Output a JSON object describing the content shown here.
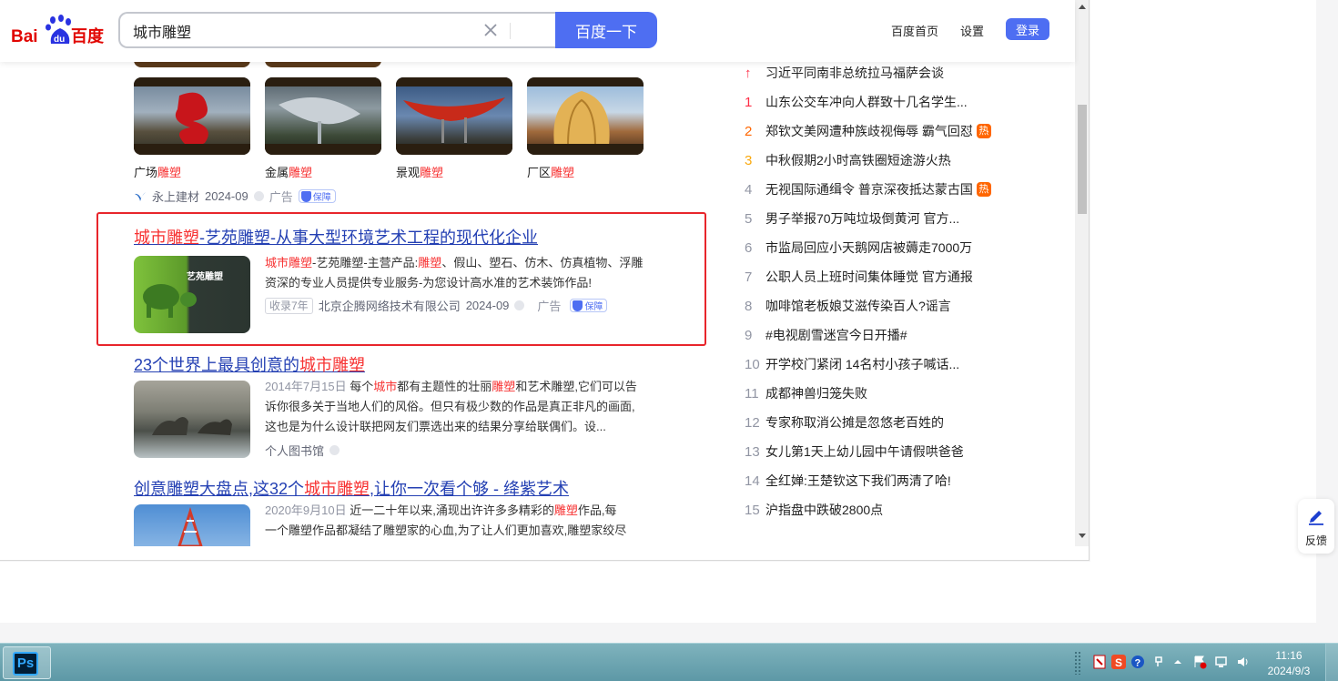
{
  "header": {
    "logo_text": "Bai百度",
    "search_value": "城市雕塑",
    "search_button": "百度一下",
    "links": [
      "百度首页",
      "设置"
    ],
    "login": "登录"
  },
  "ad_gallery": {
    "items": [
      {
        "prefix": "广场",
        "hl": "雕塑"
      },
      {
        "prefix": "金属",
        "hl": "雕塑"
      },
      {
        "prefix": "景观",
        "hl": "雕塑"
      },
      {
        "prefix": "厂区",
        "hl": "雕塑"
      }
    ],
    "meta": {
      "source": "永上建材",
      "date": "2024-09",
      "ad": "广告",
      "bao": "保障"
    }
  },
  "results": [
    {
      "title_hl": "城市雕塑",
      "title_rest": "-艺苑雕塑-从事大型环境艺术工程的现代化企业",
      "thumb_text": "艺苑雕塑",
      "line1_hl1": "城市雕塑",
      "line1_mid": "-艺苑雕塑-主营产品:",
      "line1_hl2": "雕塑",
      "line1_rest": "、假山、塑石、仿木、仿真植物、浮雕",
      "line2": "资深的专业人员提供专业服务-为您设计高水准的艺术装饰作品!",
      "tag": "收录7年",
      "source": "北京企腾网络技术有限公司",
      "date": "2024-09",
      "ad": "广告",
      "bao": "保障"
    },
    {
      "title_pre": "23个世界上最具创意的",
      "title_hl": "城市雕塑",
      "date": "2014年7月15日",
      "l1_a": "每个",
      "l1_hl1": "城市",
      "l1_b": "都有主题性的壮丽",
      "l1_hl2": "雕塑",
      "l1_c": "和艺术雕塑,它们可以告",
      "line2": "诉你很多关于当地人们的风俗。但只有极少数的作品是真正非凡的画面,",
      "line3": "这也是为什么设计联把网友们票选出来的结果分享给联偶们。设...",
      "source": "个人图书馆"
    },
    {
      "title_pre": "创意雕塑大盘点,这32个",
      "title_hl": "城市雕塑",
      "title_post": ",让你一次看个够 - 绛紫艺术",
      "date": "2020年9月10日",
      "l1_a": "近一二十年以来,涌现出许许多多精彩的",
      "l1_hl": "雕塑",
      "l1_b": "作品,每",
      "line2": "一个雕塑作品都凝结了雕塑家的心血,为了让人们更加喜欢,雕塑家绞尽"
    }
  ],
  "hotlist": [
    {
      "rank": "↑",
      "text": "习近平同南非总统拉马福萨会谈",
      "badge": ""
    },
    {
      "rank": "1",
      "text": "山东公交车冲向人群致十几名学生...",
      "badge": ""
    },
    {
      "rank": "2",
      "text": "郑钦文美网遭种族歧视侮辱 霸气回怼",
      "badge": "热"
    },
    {
      "rank": "3",
      "text": "中秋假期2小时高铁圈短途游火热",
      "badge": ""
    },
    {
      "rank": "4",
      "text": "无视国际通缉令 普京深夜抵达蒙古国",
      "badge": "热"
    },
    {
      "rank": "5",
      "text": "男子举报70万吨垃圾倒黄河 官方...",
      "badge": ""
    },
    {
      "rank": "6",
      "text": "市监局回应小天鹅网店被薅走7000万",
      "badge": ""
    },
    {
      "rank": "7",
      "text": "公职人员上班时间集体睡觉 官方通报",
      "badge": ""
    },
    {
      "rank": "8",
      "text": "咖啡馆老板娘艾滋传染百人?谣言",
      "badge": ""
    },
    {
      "rank": "9",
      "text": "#电视剧雪迷宫今日开播#",
      "badge": ""
    },
    {
      "rank": "10",
      "text": "开学校门紧闭 14名村小孩子喊话...",
      "badge": ""
    },
    {
      "rank": "11",
      "text": "成都神兽归笼失败",
      "badge": ""
    },
    {
      "rank": "12",
      "text": "专家称取消公摊是忽悠老百姓的",
      "badge": ""
    },
    {
      "rank": "13",
      "text": "女儿第1天上幼儿园中午请假哄爸爸",
      "badge": ""
    },
    {
      "rank": "14",
      "text": "全红婵:王楚钦这下我们两清了哈!",
      "badge": ""
    },
    {
      "rank": "15",
      "text": "沪指盘中跌破2800点",
      "badge": ""
    }
  ],
  "feedback": "反馈",
  "taskbar": {
    "app": "Ps",
    "time": "11:16",
    "date": "2024/9/3"
  },
  "colors": {
    "brand_blue": "#4e6ef2",
    "link_blue": "#2440b3",
    "highlight_red": "#f73131",
    "box_red": "#e8252b"
  }
}
